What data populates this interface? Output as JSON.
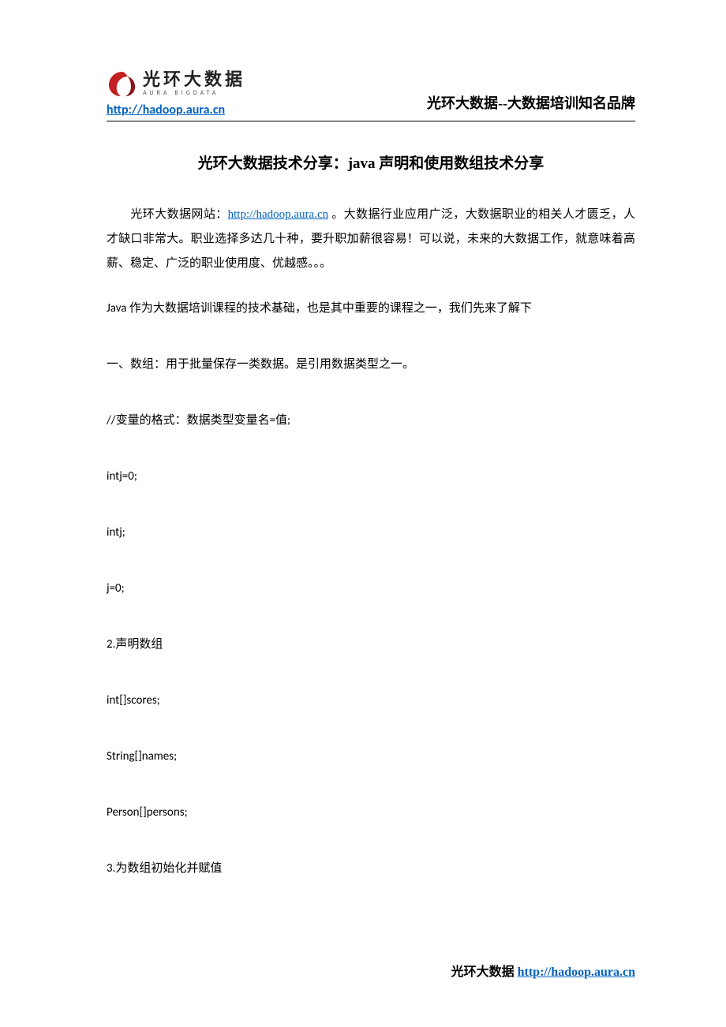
{
  "header": {
    "logo_cn": "光环大数据",
    "logo_en": "AURA  BIGDATA",
    "header_link_text": "http://hadoop.aura.cn",
    "header_link_href": "http://hadoop.aura.cn",
    "brand_slogan": "光环大数据--大数据培训知名品牌"
  },
  "title": "光环大数据技术分享：java 声明和使用数组技术分享",
  "intro": {
    "pre": "光环大数据网站：",
    "link_text": "http://hadoop.aura.cn",
    "link_href": "http://hadoop.aura.cn",
    "post": " 。大数据行业应用广泛，大数据职业的相关人才匮乏，人才缺口非常大。职业选择多达几十种，要升职加薪很容易！可以说，未来的大数据工作，就意味着高薪、稳定、广泛的职业使用度、优越感。。。"
  },
  "body": {
    "p1": "Java 作为大数据培训课程的技术基础，也是其中重要的课程之一，我们先来了解下",
    "p2": "一、数组：用于批量保存一类数据。是引用数据类型之一。",
    "p3": "//变量的格式：数据类型变量名=值;",
    "p4": "intj=0;",
    "p5": "intj;",
    "p6": "j=0;",
    "p7": "2.声明数组",
    "p8": "int[]scores;",
    "p9": "String[]names;",
    "p10": "Person[]persons;",
    "p11": "3.为数组初始化并赋值"
  },
  "footer": {
    "label": "光环大数据  ",
    "link_text": "http://hadoop.aura.cn",
    "link_href": "http://hadoop.aura.cn"
  }
}
